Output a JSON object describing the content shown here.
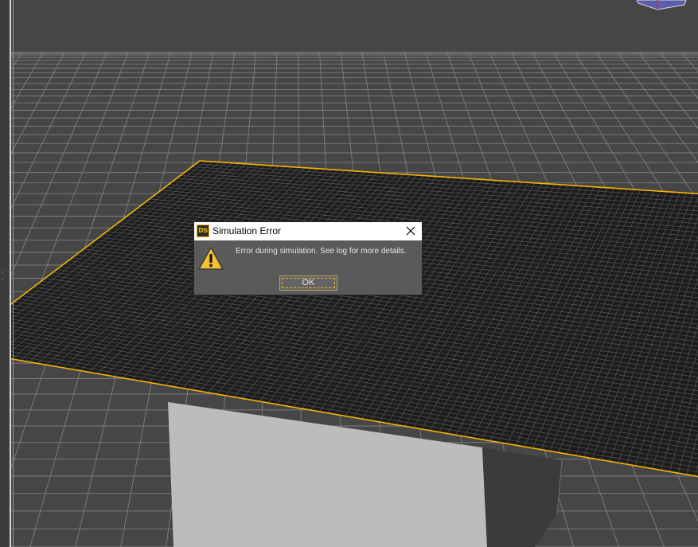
{
  "dialog": {
    "title": "Simulation Error",
    "app_icon_text": "DS",
    "message": "Error during simulation. See log for more details.",
    "ok_label": "OK"
  },
  "icons": {
    "app": "daz-studio-app-icon",
    "close": "close-icon",
    "warning": "warning-icon",
    "view-cube": "view-cube-icon"
  },
  "colors": {
    "viewport_bg": "#464646",
    "grid_line": "#8a8a8a",
    "plane_fill": "#1c1c1c",
    "plane_grid": "#545454",
    "selection_outline": "#f5b400",
    "box_face_light": "#bcbcbc",
    "box_face_dark": "#3b3b3b",
    "dialog_bg": "#5a5a5a",
    "titlebar_bg": "#ffffff",
    "warning_fill": "#f2c230"
  }
}
